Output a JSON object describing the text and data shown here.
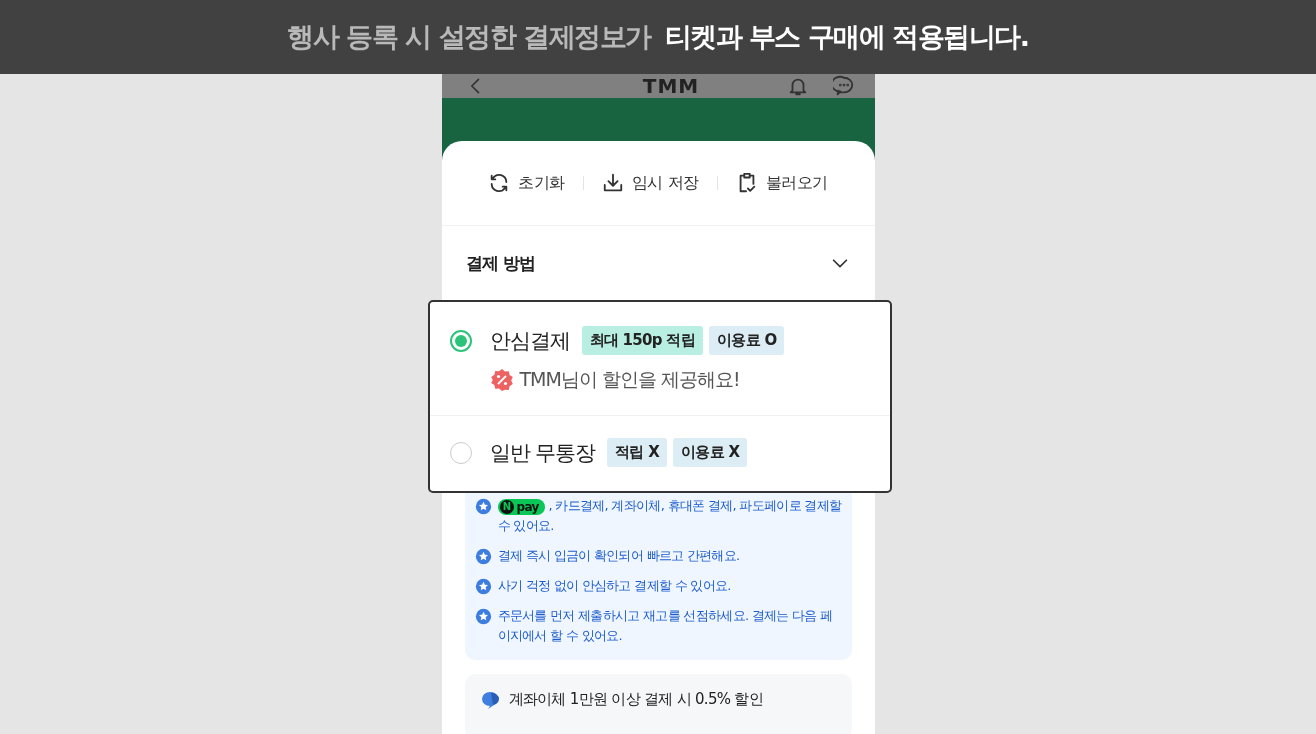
{
  "banner": {
    "lead": "행사 등록 시 설정한 결제정보가",
    "emphasis": "티켓과 부스 구매에 적용됩니다."
  },
  "header": {
    "logo": "TMM"
  },
  "toolbar": [
    {
      "kind": "reset",
      "label": "초기화"
    },
    {
      "kind": "save",
      "label": "임시 저장"
    },
    {
      "kind": "load",
      "label": "불러오기"
    }
  ],
  "section": {
    "title": "결제 방법"
  },
  "options": [
    {
      "label": "안심결제",
      "selected": true,
      "tags": [
        {
          "kind": "point",
          "text": "최대 150p 적립"
        },
        {
          "kind": "fee",
          "text": "이용료 O"
        }
      ],
      "note": "TMM님이 할인을 제공해요!"
    },
    {
      "label": "일반 무통장",
      "selected": false,
      "tags": [
        {
          "kind": "fee",
          "text": "적립 X"
        },
        {
          "kind": "fee",
          "text": "이용료 X"
        }
      ]
    }
  ],
  "notices": [
    {
      "badge": {
        "mark": "N",
        "text": "pay"
      },
      "text": ", 카드결제, 계좌이체, 휴대폰 결제, 파도페이로 결제할 수 있어요."
    },
    {
      "text": "결제 즉시 입금이 확인되어 빠르고 간편해요."
    },
    {
      "text": "사기 걱정 없이 안심하고 결제할 수 있어요."
    },
    {
      "text": "주문서를 먼저 제출하시고 재고를 선점하세요. 결제는 다음 페이지에서 할 수 있어요."
    }
  ],
  "discount": {
    "text": "계좌이체 1만원 이상 결제 시 0.5% 할인"
  }
}
